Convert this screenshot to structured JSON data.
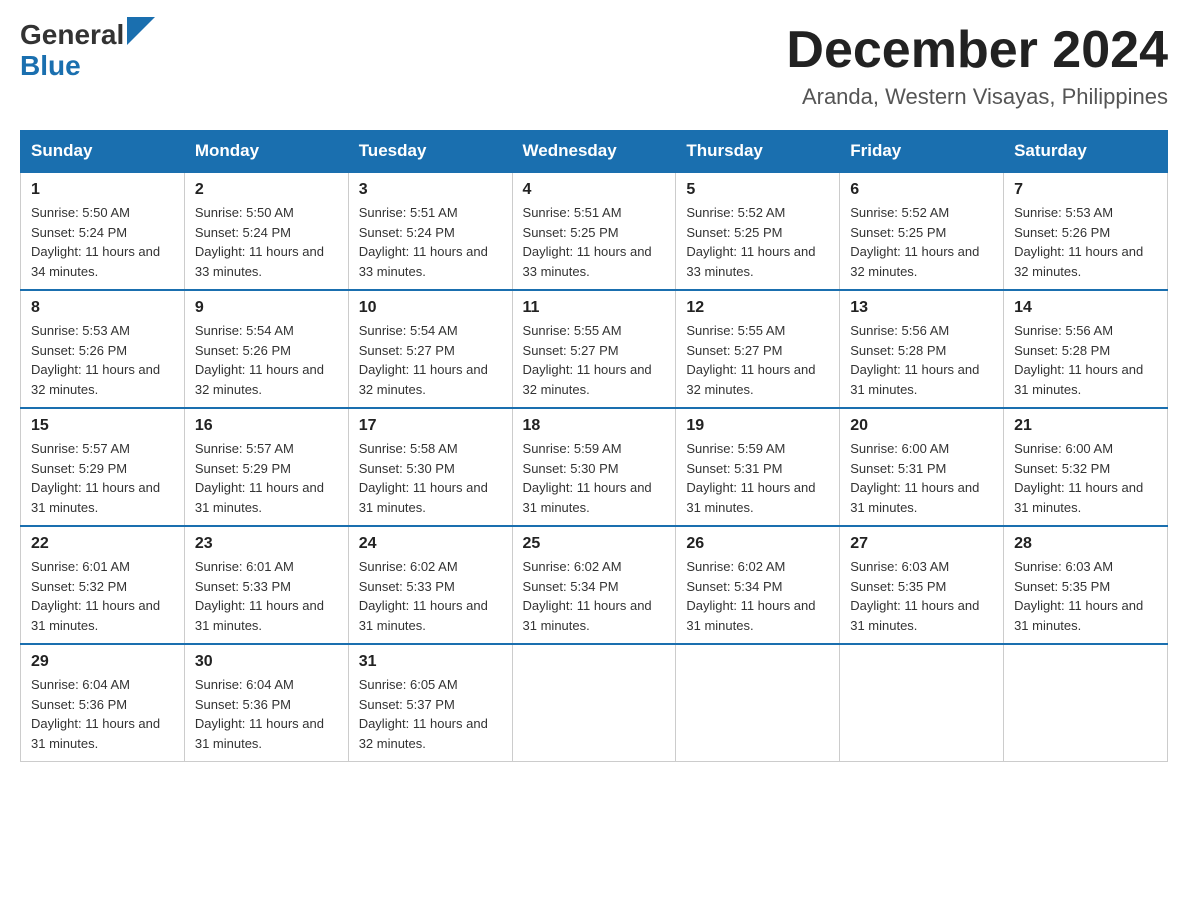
{
  "header": {
    "logo_general": "General",
    "logo_blue": "Blue",
    "month_title": "December 2024",
    "location": "Aranda, Western Visayas, Philippines"
  },
  "days_of_week": [
    "Sunday",
    "Monday",
    "Tuesday",
    "Wednesday",
    "Thursday",
    "Friday",
    "Saturday"
  ],
  "weeks": [
    [
      {
        "day": "1",
        "sunrise": "Sunrise: 5:50 AM",
        "sunset": "Sunset: 5:24 PM",
        "daylight": "Daylight: 11 hours and 34 minutes."
      },
      {
        "day": "2",
        "sunrise": "Sunrise: 5:50 AM",
        "sunset": "Sunset: 5:24 PM",
        "daylight": "Daylight: 11 hours and 33 minutes."
      },
      {
        "day": "3",
        "sunrise": "Sunrise: 5:51 AM",
        "sunset": "Sunset: 5:24 PM",
        "daylight": "Daylight: 11 hours and 33 minutes."
      },
      {
        "day": "4",
        "sunrise": "Sunrise: 5:51 AM",
        "sunset": "Sunset: 5:25 PM",
        "daylight": "Daylight: 11 hours and 33 minutes."
      },
      {
        "day": "5",
        "sunrise": "Sunrise: 5:52 AM",
        "sunset": "Sunset: 5:25 PM",
        "daylight": "Daylight: 11 hours and 33 minutes."
      },
      {
        "day": "6",
        "sunrise": "Sunrise: 5:52 AM",
        "sunset": "Sunset: 5:25 PM",
        "daylight": "Daylight: 11 hours and 32 minutes."
      },
      {
        "day": "7",
        "sunrise": "Sunrise: 5:53 AM",
        "sunset": "Sunset: 5:26 PM",
        "daylight": "Daylight: 11 hours and 32 minutes."
      }
    ],
    [
      {
        "day": "8",
        "sunrise": "Sunrise: 5:53 AM",
        "sunset": "Sunset: 5:26 PM",
        "daylight": "Daylight: 11 hours and 32 minutes."
      },
      {
        "day": "9",
        "sunrise": "Sunrise: 5:54 AM",
        "sunset": "Sunset: 5:26 PM",
        "daylight": "Daylight: 11 hours and 32 minutes."
      },
      {
        "day": "10",
        "sunrise": "Sunrise: 5:54 AM",
        "sunset": "Sunset: 5:27 PM",
        "daylight": "Daylight: 11 hours and 32 minutes."
      },
      {
        "day": "11",
        "sunrise": "Sunrise: 5:55 AM",
        "sunset": "Sunset: 5:27 PM",
        "daylight": "Daylight: 11 hours and 32 minutes."
      },
      {
        "day": "12",
        "sunrise": "Sunrise: 5:55 AM",
        "sunset": "Sunset: 5:27 PM",
        "daylight": "Daylight: 11 hours and 32 minutes."
      },
      {
        "day": "13",
        "sunrise": "Sunrise: 5:56 AM",
        "sunset": "Sunset: 5:28 PM",
        "daylight": "Daylight: 11 hours and 31 minutes."
      },
      {
        "day": "14",
        "sunrise": "Sunrise: 5:56 AM",
        "sunset": "Sunset: 5:28 PM",
        "daylight": "Daylight: 11 hours and 31 minutes."
      }
    ],
    [
      {
        "day": "15",
        "sunrise": "Sunrise: 5:57 AM",
        "sunset": "Sunset: 5:29 PM",
        "daylight": "Daylight: 11 hours and 31 minutes."
      },
      {
        "day": "16",
        "sunrise": "Sunrise: 5:57 AM",
        "sunset": "Sunset: 5:29 PM",
        "daylight": "Daylight: 11 hours and 31 minutes."
      },
      {
        "day": "17",
        "sunrise": "Sunrise: 5:58 AM",
        "sunset": "Sunset: 5:30 PM",
        "daylight": "Daylight: 11 hours and 31 minutes."
      },
      {
        "day": "18",
        "sunrise": "Sunrise: 5:59 AM",
        "sunset": "Sunset: 5:30 PM",
        "daylight": "Daylight: 11 hours and 31 minutes."
      },
      {
        "day": "19",
        "sunrise": "Sunrise: 5:59 AM",
        "sunset": "Sunset: 5:31 PM",
        "daylight": "Daylight: 11 hours and 31 minutes."
      },
      {
        "day": "20",
        "sunrise": "Sunrise: 6:00 AM",
        "sunset": "Sunset: 5:31 PM",
        "daylight": "Daylight: 11 hours and 31 minutes."
      },
      {
        "day": "21",
        "sunrise": "Sunrise: 6:00 AM",
        "sunset": "Sunset: 5:32 PM",
        "daylight": "Daylight: 11 hours and 31 minutes."
      }
    ],
    [
      {
        "day": "22",
        "sunrise": "Sunrise: 6:01 AM",
        "sunset": "Sunset: 5:32 PM",
        "daylight": "Daylight: 11 hours and 31 minutes."
      },
      {
        "day": "23",
        "sunrise": "Sunrise: 6:01 AM",
        "sunset": "Sunset: 5:33 PM",
        "daylight": "Daylight: 11 hours and 31 minutes."
      },
      {
        "day": "24",
        "sunrise": "Sunrise: 6:02 AM",
        "sunset": "Sunset: 5:33 PM",
        "daylight": "Daylight: 11 hours and 31 minutes."
      },
      {
        "day": "25",
        "sunrise": "Sunrise: 6:02 AM",
        "sunset": "Sunset: 5:34 PM",
        "daylight": "Daylight: 11 hours and 31 minutes."
      },
      {
        "day": "26",
        "sunrise": "Sunrise: 6:02 AM",
        "sunset": "Sunset: 5:34 PM",
        "daylight": "Daylight: 11 hours and 31 minutes."
      },
      {
        "day": "27",
        "sunrise": "Sunrise: 6:03 AM",
        "sunset": "Sunset: 5:35 PM",
        "daylight": "Daylight: 11 hours and 31 minutes."
      },
      {
        "day": "28",
        "sunrise": "Sunrise: 6:03 AM",
        "sunset": "Sunset: 5:35 PM",
        "daylight": "Daylight: 11 hours and 31 minutes."
      }
    ],
    [
      {
        "day": "29",
        "sunrise": "Sunrise: 6:04 AM",
        "sunset": "Sunset: 5:36 PM",
        "daylight": "Daylight: 11 hours and 31 minutes."
      },
      {
        "day": "30",
        "sunrise": "Sunrise: 6:04 AM",
        "sunset": "Sunset: 5:36 PM",
        "daylight": "Daylight: 11 hours and 31 minutes."
      },
      {
        "day": "31",
        "sunrise": "Sunrise: 6:05 AM",
        "sunset": "Sunset: 5:37 PM",
        "daylight": "Daylight: 11 hours and 32 minutes."
      },
      null,
      null,
      null,
      null
    ]
  ]
}
